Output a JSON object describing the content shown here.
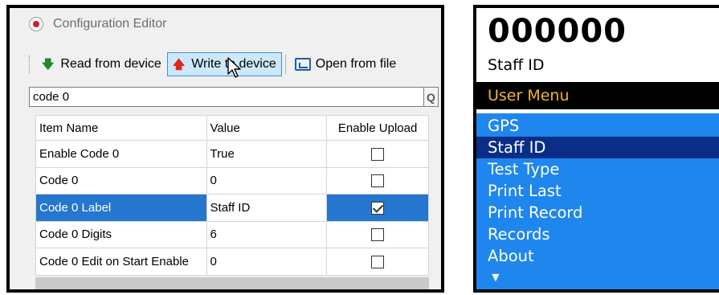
{
  "editor": {
    "title": "Configuration Editor",
    "toolbar": {
      "read_label": "Read from device",
      "write_label": "Write to device",
      "open_label": "Open from file"
    },
    "search": {
      "value": "code 0"
    },
    "columns": {
      "name": "Item Name",
      "value": "Value",
      "upload": "Enable Upload"
    },
    "rows": [
      {
        "name": "Enable Code 0",
        "value": "True",
        "upload": false
      },
      {
        "name": "Code 0",
        "value": "0",
        "upload": false
      },
      {
        "name": "Code 0 Label",
        "value": "Staff ID",
        "upload": true
      },
      {
        "name": "Code 0 Digits",
        "value": "6",
        "upload": false
      },
      {
        "name": "Code 0 Edit on Start Enable",
        "value": "0",
        "upload": false
      }
    ],
    "selected_row": 2
  },
  "device": {
    "code_value": "000000",
    "code_label": "Staff ID",
    "menu_title": "User Menu",
    "menu_items": [
      "GPS",
      "Staff ID",
      "Test Type",
      "Print Last",
      "Print Record",
      "Records",
      "About"
    ],
    "active_item": 1,
    "colors": {
      "menu_background": "#1f86ee",
      "menu_active": "#0a2e86",
      "menu_title_text": "#f3b628"
    }
  }
}
